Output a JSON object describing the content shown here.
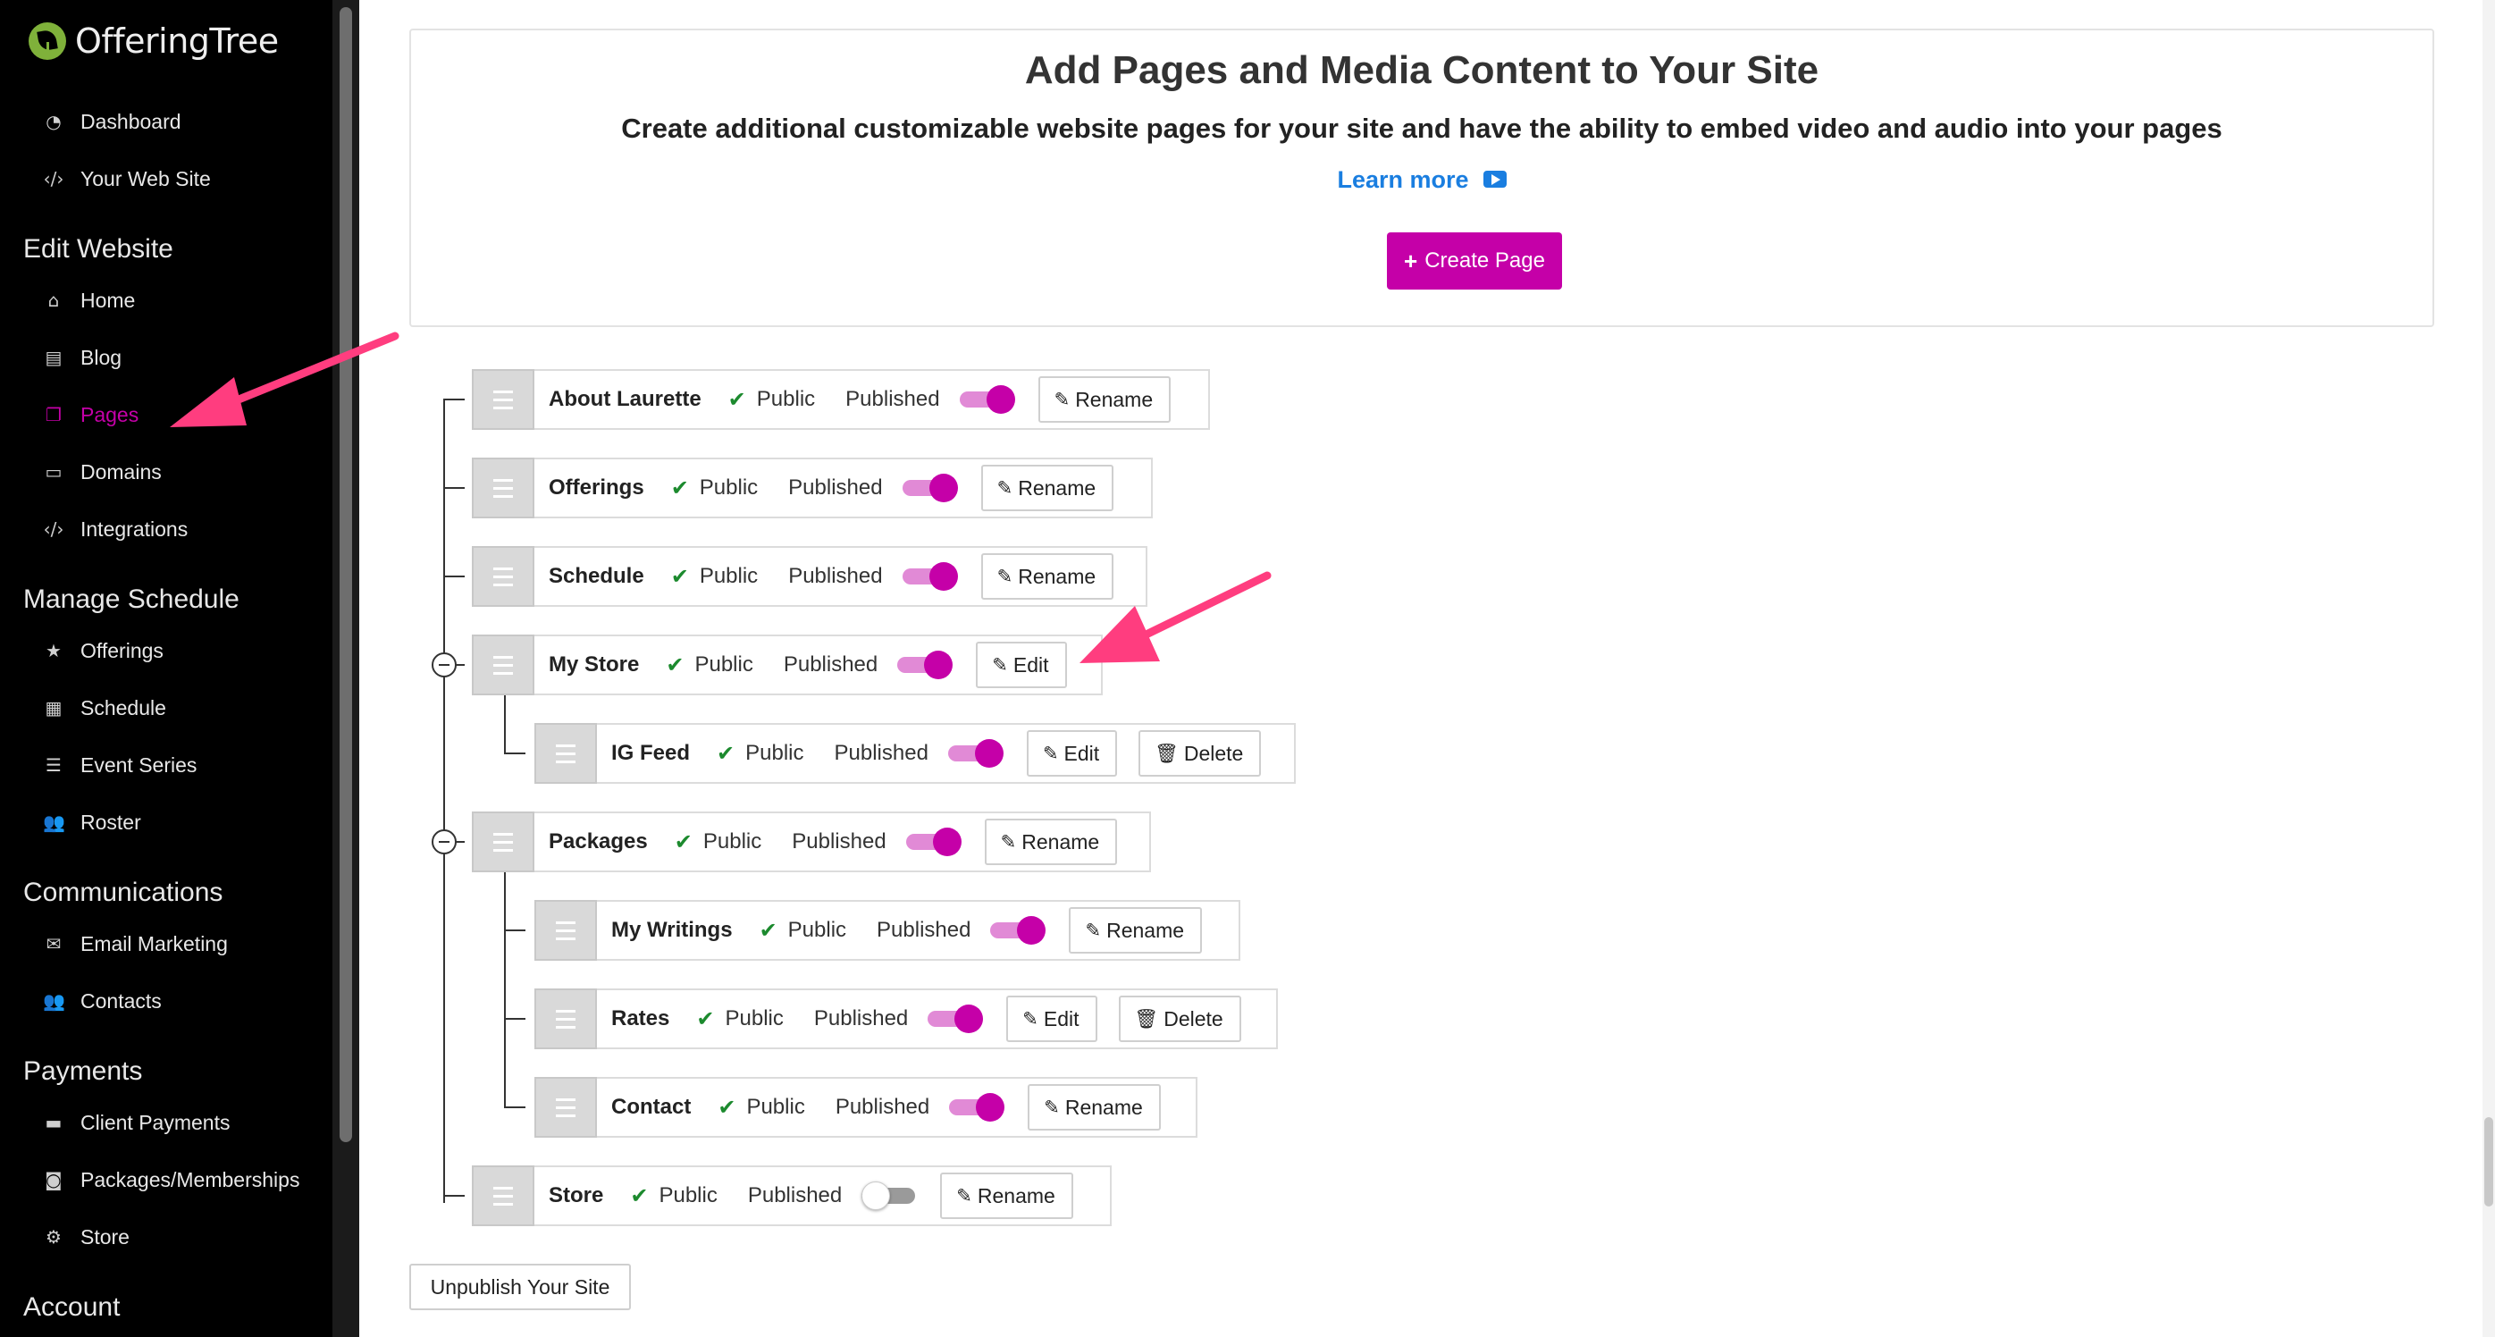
{
  "app": {
    "brand": "OfferingTree"
  },
  "sidebar": {
    "top_items": [
      {
        "label": "Dashboard",
        "icon": "dashboard-icon"
      },
      {
        "label": "Your Web Site",
        "icon": "code-icon"
      }
    ],
    "sections": [
      {
        "title": "Edit Website",
        "items": [
          {
            "label": "Home",
            "icon": "home-icon"
          },
          {
            "label": "Blog",
            "icon": "newspaper-icon"
          },
          {
            "label": "Pages",
            "icon": "copy-icon",
            "active": true
          },
          {
            "label": "Domains",
            "icon": "window-icon"
          },
          {
            "label": "Integrations",
            "icon": "code-icon"
          }
        ]
      },
      {
        "title": "Manage Schedule",
        "items": [
          {
            "label": "Offerings",
            "icon": "star-icon"
          },
          {
            "label": "Schedule",
            "icon": "calendar-icon"
          },
          {
            "label": "Event Series",
            "icon": "list-icon"
          },
          {
            "label": "Roster",
            "icon": "users-icon"
          }
        ]
      },
      {
        "title": "Communications",
        "items": [
          {
            "label": "Email Marketing",
            "icon": "envelope-icon"
          },
          {
            "label": "Contacts",
            "icon": "users-icon"
          }
        ]
      },
      {
        "title": "Payments",
        "items": [
          {
            "label": "Client Payments",
            "icon": "credit-card-icon"
          },
          {
            "label": "Packages/Memberships",
            "icon": "money-icon"
          },
          {
            "label": "Store",
            "icon": "gear-icon"
          }
        ]
      },
      {
        "title": "Account",
        "items": []
      }
    ],
    "active_color": "#c500a8"
  },
  "hero": {
    "title": "Add Pages and Media Content to Your Site",
    "subtitle": "Create additional customizable website pages for your site and have the ability to embed video and audio into your pages",
    "learn_more": "Learn more",
    "create_button": "Create Page"
  },
  "pages": [
    {
      "name": "About Laurette",
      "visibility": "Public",
      "status": "Published",
      "published": true,
      "actions": [
        "Rename"
      ],
      "level": 0
    },
    {
      "name": "Offerings",
      "visibility": "Public",
      "status": "Published",
      "published": true,
      "actions": [
        "Rename"
      ],
      "level": 0
    },
    {
      "name": "Schedule",
      "visibility": "Public",
      "status": "Published",
      "published": true,
      "actions": [
        "Rename"
      ],
      "level": 0
    },
    {
      "name": "My Store",
      "visibility": "Public",
      "status": "Published",
      "published": true,
      "actions": [
        "Edit"
      ],
      "level": 0,
      "expanded": true
    },
    {
      "name": "IG Feed",
      "visibility": "Public",
      "status": "Published",
      "published": true,
      "actions": [
        "Edit",
        "Delete"
      ],
      "level": 1
    },
    {
      "name": "Packages",
      "visibility": "Public",
      "status": "Published",
      "published": true,
      "actions": [
        "Rename"
      ],
      "level": 0,
      "expanded": true
    },
    {
      "name": "My Writings",
      "visibility": "Public",
      "status": "Published",
      "published": true,
      "actions": [
        "Rename"
      ],
      "level": 1
    },
    {
      "name": "Rates",
      "visibility": "Public",
      "status": "Published",
      "published": true,
      "actions": [
        "Edit",
        "Delete"
      ],
      "level": 1
    },
    {
      "name": "Contact",
      "visibility": "Public",
      "status": "Published",
      "published": true,
      "actions": [
        "Rename"
      ],
      "level": 1
    },
    {
      "name": "Store",
      "visibility": "Public",
      "status": "Published",
      "published": false,
      "actions": [
        "Rename"
      ],
      "level": 0
    }
  ],
  "footer": {
    "unpublish_button": "Unpublish Your Site"
  },
  "colors": {
    "accent": "#c500a8",
    "link": "#1a7ee0",
    "check": "#1c8a2e",
    "annotation_arrow": "#ff3d7f"
  }
}
